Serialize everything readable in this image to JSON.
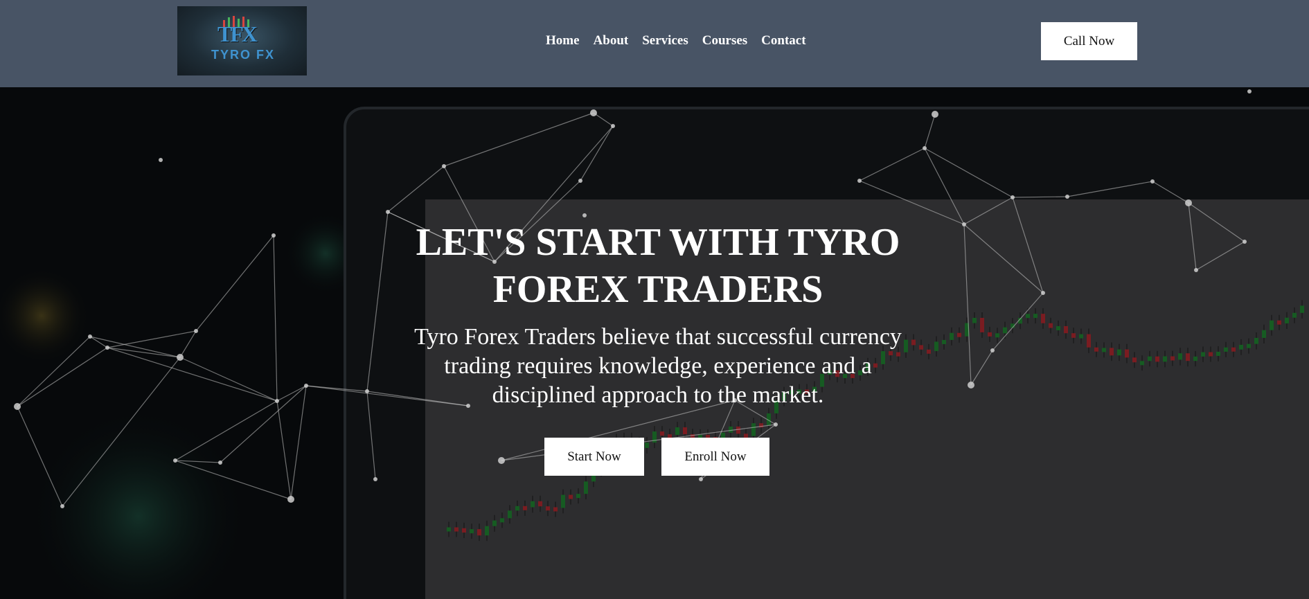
{
  "header": {
    "logo": {
      "mark": "TFX",
      "text": "TYRO FX"
    },
    "nav": [
      "Home",
      "About",
      "Services",
      "Courses",
      "Contact"
    ],
    "call_label": "Call Now"
  },
  "hero": {
    "title_line1": "LET'S START WITH TYRO",
    "title_line2": "FOREX TRADERS",
    "subtitle": "Tyro Forex Traders believe that successful currency trading requires knowledge, experience and a disciplined approach to the market.",
    "start_label": "Start Now",
    "enroll_label": "Enroll Now"
  },
  "colors": {
    "header_bg": "#485465",
    "button_bg": "#ffffff",
    "candle_up": "#1e7a2e",
    "candle_down": "#a3262c"
  }
}
